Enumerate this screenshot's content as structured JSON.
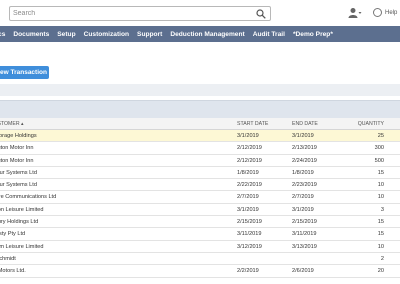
{
  "search": {
    "placeholder": "Search"
  },
  "header": {
    "help_label": "Help"
  },
  "nav": {
    "items": [
      "tics",
      "Documents",
      "Setup",
      "Customization",
      "Support",
      "Deduction Management",
      "Audit Trail",
      "*Demo Prep*"
    ]
  },
  "toolbar": {
    "new_transaction_label": "ew Transaction"
  },
  "table": {
    "headers": {
      "customer": "CUSTOMER ▴",
      "start": "START DATE",
      "end": "END DATE",
      "qty": "QUANTITY"
    },
    "rows": [
      {
        "customer": "nchorage Holdings",
        "start": "3/1/2019",
        "end": "3/1/2019",
        "qty": "25"
      },
      {
        "customer": "rlington Motor Inn",
        "start": "2/12/2019",
        "end": "2/13/2019",
        "qty": "300"
      },
      {
        "customer": "rlington Motor Inn",
        "start": "2/12/2019",
        "end": "2/24/2019",
        "qty": "500"
      },
      {
        "customer": "rmour Systems Ltd",
        "start": "1/8/2019",
        "end": "1/8/2019",
        "qty": "15"
      },
      {
        "customer": "rmour Systems Ltd",
        "start": "2/22/2019",
        "end": "2/23/2019",
        "qty": "10"
      },
      {
        "customer": "alibre Communications Ltd",
        "start": "2/7/2019",
        "end": "2/7/2019",
        "qty": "10"
      },
      {
        "customer": "arlton Leisure Limited",
        "start": "3/1/2019",
        "end": "3/1/2019",
        "qty": "3"
      },
      {
        "customer": "entury Holdings Ltd",
        "start": "2/15/2019",
        "end": "2/15/2019",
        "qty": "15"
      },
      {
        "customer": "ynasty Pty Ltd",
        "start": "3/11/2019",
        "end": "3/11/2019",
        "qty": "15"
      },
      {
        "customer": "pham Leisure Limited",
        "start": "3/12/2019",
        "end": "3/13/2019",
        "qty": "10"
      },
      {
        "customer": "ic Schmidt",
        "start": "",
        "end": "",
        "qty": "2"
      },
      {
        "customer": "on Motors Ltd.",
        "start": "2/2/2019",
        "end": "2/6/2019",
        "qty": "20"
      }
    ]
  }
}
